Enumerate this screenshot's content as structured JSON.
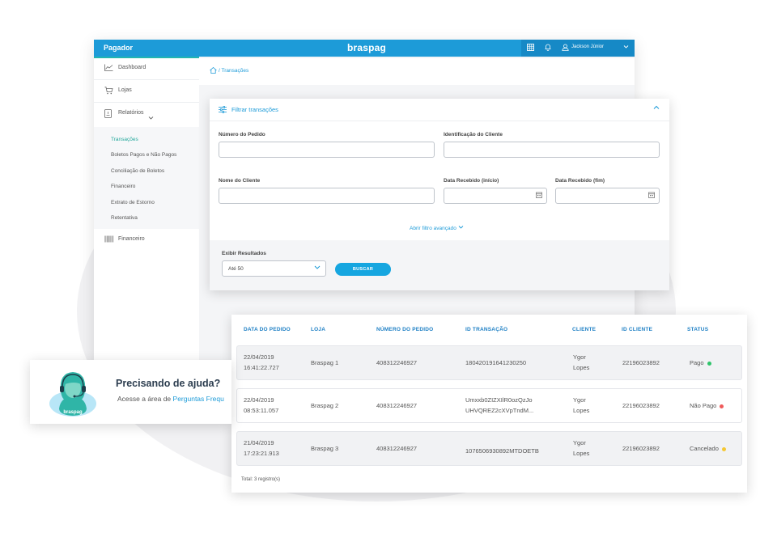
{
  "topbar": {
    "brand": "Pagador",
    "logo": "braspag",
    "user": "Jackson Júnior",
    "icons": [
      "grid-icon",
      "bell-icon",
      "user-icon",
      "chevron-down-icon"
    ]
  },
  "sidebar": {
    "items": [
      {
        "label": "Dashboard",
        "icon": "chart-icon"
      },
      {
        "label": "Lojas",
        "icon": "cart-icon"
      },
      {
        "label": "Relatórios",
        "icon": "report-icon"
      },
      {
        "label": "Financeiro",
        "icon": "barcode-icon"
      }
    ],
    "submenu": [
      {
        "label": "Transações",
        "active": true
      },
      {
        "label": "Boletos Pagos e Não Pagos"
      },
      {
        "label": "Conciliação de Boletos"
      },
      {
        "label": "Financeiro"
      },
      {
        "label": "Extrato de Estorno"
      },
      {
        "label": "Retentativa"
      }
    ]
  },
  "breadcrumb": {
    "text": "/ Transações"
  },
  "filter": {
    "title": "Filtrar transações",
    "fields": {
      "order_number": {
        "label": "Número do Pedido",
        "value": ""
      },
      "client_id": {
        "label": "Identificação do Cliente",
        "value": ""
      },
      "client_name": {
        "label": "Nome do Cliente",
        "value": ""
      },
      "date_start": {
        "label": "Data Recebido (início)",
        "value": ""
      },
      "date_end": {
        "label": "Data Recebido (fim)",
        "value": ""
      }
    },
    "advanced": "Abrir filtro avançado",
    "results_label": "Exibir Resultados",
    "results_value": "Até 50",
    "search_button": "BUSCAR"
  },
  "table": {
    "headers": [
      "DATA DO PEDIDO",
      "LOJA",
      "NÚMERO DO PEDIDO",
      "ID TRANSAÇÃO",
      "CLIENTE",
      "ID CLIENTE",
      "STATUS"
    ],
    "rows": [
      {
        "date": "22/04/2019",
        "time": "16:41:22.727",
        "store": "Braspag 1",
        "order": "408312246927",
        "tid1": "180420191641230250",
        "tid2": "",
        "client1": "Ygor",
        "client2": "Lopes",
        "client_id": "22196023892",
        "status": "Pago",
        "status_color": "#2ec46a"
      },
      {
        "date": "22/04/2019",
        "time": "08:53:11.057",
        "store": "Braspag 2",
        "order": "408312246927",
        "tid1": "Umxxb0ZIZXIlR0ozQzJo",
        "tid2": "UHVQREZ2cXVpTndM...",
        "client1": "Ygor",
        "client2": "Lopes",
        "client_id": "22196023892",
        "status": "Não Pago",
        "status_color": "#ef5a5a"
      },
      {
        "date": "21/04/2019",
        "time": "17:23:21.913",
        "store": "Braspag 3",
        "order": "408312246927",
        "tid1": "1076506930892MTDOETB",
        "tid2": "",
        "client1": "Ygor",
        "client2": "Lopes",
        "client_id": "22196023892",
        "status": "Cancelado",
        "status_color": "#f5c833"
      }
    ],
    "total": "Total: 3 registro(s)"
  },
  "help": {
    "title": "Precisando de ajuda?",
    "text": "Acesse a área de",
    "link": "Perguntas Frequ",
    "avatar_logo": "braspag"
  },
  "colors": {
    "primary": "#1d9bd8",
    "teal": "#23b6b0",
    "paid": "#2ec46a",
    "unpaid": "#ef5a5a",
    "canceled": "#f5c833"
  }
}
